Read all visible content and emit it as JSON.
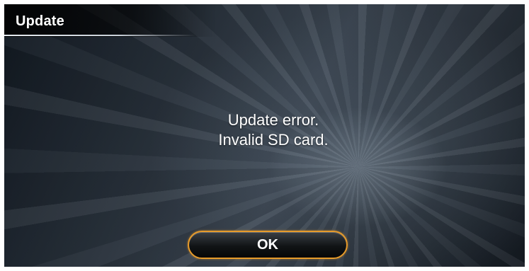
{
  "dialog": {
    "title": "Update",
    "message_line1": "Update error.",
    "message_line2": "Invalid SD card.",
    "ok_label": "OK"
  },
  "colors": {
    "button_border": "#e79b2a",
    "text": "#ffffff"
  }
}
